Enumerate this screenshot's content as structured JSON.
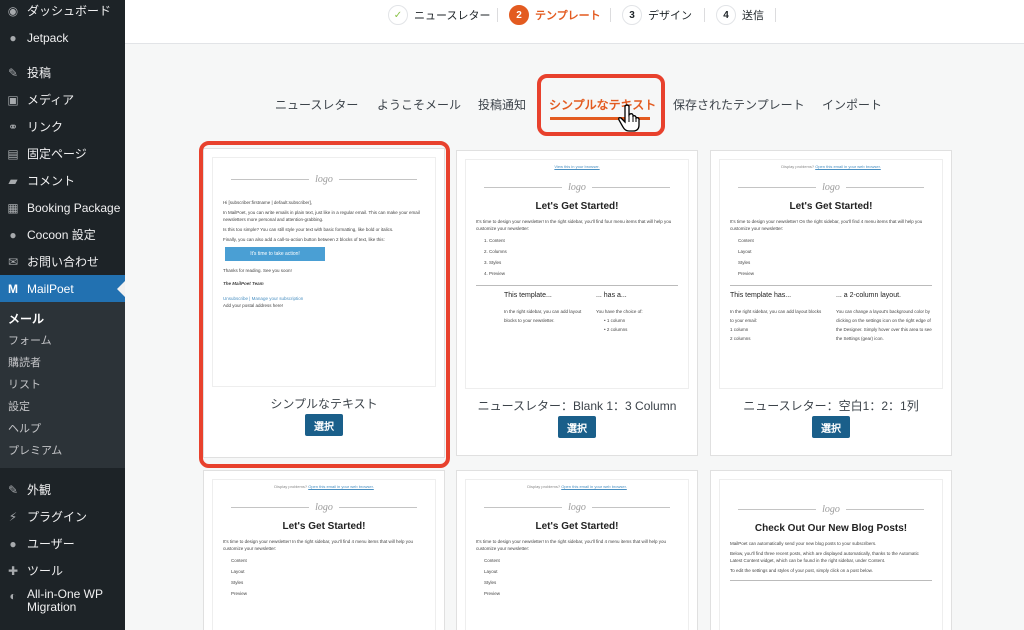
{
  "sidebar": {
    "items": [
      {
        "icon": "dashboard-icon",
        "glyph": "◉",
        "label": "ダッシュボード"
      },
      {
        "icon": "jetpack-icon",
        "glyph": "●",
        "label": "Jetpack"
      },
      {
        "icon": "pin-icon",
        "glyph": "✎",
        "label": "投稿"
      },
      {
        "icon": "media-icon",
        "glyph": "▣",
        "label": "メディア"
      },
      {
        "icon": "link-icon",
        "glyph": "⚭",
        "label": "リンク"
      },
      {
        "icon": "page-icon",
        "glyph": "▤",
        "label": "固定ページ"
      },
      {
        "icon": "comment-icon",
        "glyph": "▰",
        "label": "コメント"
      },
      {
        "icon": "calendar-icon",
        "glyph": "▦",
        "label": "Booking Package"
      },
      {
        "icon": "cocoon-icon",
        "glyph": "●",
        "label": "Cocoon 設定"
      },
      {
        "icon": "mail-icon",
        "glyph": "✉",
        "label": "お問い合わせ"
      },
      {
        "icon": "mailpoet-icon",
        "glyph": "M",
        "label": "MailPoet"
      }
    ],
    "submenu": [
      "メール",
      "フォーム",
      "購読者",
      "リスト",
      "設定",
      "ヘルプ",
      "プレミアム"
    ],
    "items_after": [
      {
        "icon": "appearance-icon",
        "glyph": "✎",
        "label": "外観"
      },
      {
        "icon": "plugin-icon",
        "glyph": "⚡",
        "label": "プラグイン"
      },
      {
        "icon": "user-icon",
        "glyph": "●",
        "label": "ユーザー"
      },
      {
        "icon": "tool-icon",
        "glyph": "✚",
        "label": "ツール"
      },
      {
        "icon": "migration-icon",
        "glyph": "◐",
        "label": "All-in-One WP Migration"
      }
    ]
  },
  "steps": [
    {
      "num": "✓",
      "label": "ニュースレター"
    },
    {
      "num": "2",
      "label": "テンプレート"
    },
    {
      "num": "3",
      "label": "デザイン"
    },
    {
      "num": "4",
      "label": "送信"
    }
  ],
  "tabs": [
    "ニュースレター",
    "ようこそメール",
    "投稿通知",
    "シンプルなテキスト",
    "保存されたテンプレート",
    "インポート"
  ],
  "select_label": "選択",
  "templates": [
    {
      "label": "シンプルなテキスト",
      "logo": "logo",
      "greeting": "Hi [subscriber:firstname | default:subscriber],",
      "p1": "In MailPoet, you can write emails in plain text, just like in a regular email. This can make your email newsletters more personal and attention-grabbing.",
      "p2": "Is this too simple? You can still style your text with basic formatting, like bold or italics.",
      "p3": "Finally, you can also add a call-to-action button between 2 blocks of text, like this:",
      "cta": "It's time to take action!",
      "thanks": "Thanks for reading. See you soon!",
      "team": "The MailPoet Team",
      "footer1": "Unsubscribe | Manage your subscription",
      "footer2": "Add your postal address here!"
    },
    {
      "label": "ニュースレター：Blank 1：3 Column",
      "browser": "View this in your browser.",
      "logo": "logo",
      "title": "Let's Get Started!",
      "intro": "It's time to design your newsletter! In the right sidebar, you'll find four menu items that will help you customize your newsletter:",
      "list": [
        "1.   Content",
        "2.   Columns",
        "3.   Styles",
        "4.   Preview"
      ],
      "col1_h": "This template...",
      "col1_t": "In the right sidebar, you can add layout blocks to your newsletter.",
      "col2_h": "... has a...",
      "col2_t": "You have the choice of:",
      "col2_l1": "• 1 column",
      "col2_l2": "• 2 columns"
    },
    {
      "label": "ニュースレター：空白1：2：1列",
      "browser_pre": "Display problems?",
      "browser": "Open this email in your web browser.",
      "logo": "logo",
      "title": "Let's Get Started!",
      "intro": "It's time to design your newsletter! On the right sidebar, you'll find 4 menu items that will help you customize your newsletter:",
      "list": [
        "Content",
        "Layout",
        "Styles",
        "Preview"
      ],
      "col1_h": "This template has...",
      "col1_t": "In the right sidebar, you can add layout blocks to your email:",
      "col1_l1": "1 column",
      "col1_l2": "2 columns",
      "col2_h": "... a 2-column layout.",
      "col2_t": "You can change a layout's background color by clicking on the settings icon on the right edge of the Designer. Simply hover over this area to see the Settings (gear) icon."
    },
    {
      "browser_pre": "Display problems?",
      "browser": "Open this email in your web browser.",
      "logo": "logo",
      "title": "Let's Get Started!",
      "intro": "It's time to design your newsletter! In the right sidebar, you'll find 4 menu items that will help you customize your newsletter:",
      "list": [
        "Content",
        "Layout",
        "Styles",
        "Preview"
      ]
    },
    {
      "browser_pre": "Display problems?",
      "browser": "Open this email in your web browser.",
      "logo": "logo",
      "title": "Let's Get Started!",
      "intro": "It's time to design your newsletter! In the right sidebar, you'll find 4 menu items that will help you customize your newsletter:",
      "list": [
        "Content",
        "Layout",
        "Styles",
        "Preview"
      ]
    },
    {
      "logo": "logo",
      "title": "Check Out Our New Blog Posts!",
      "p1": "MailPoet can automatically send your new blog posts to your subscribers.",
      "p2": "Below, you'll find three recent posts, which are displayed automatically, thanks to the Automatic Latest Content widget, which can be found in the right sidebar, under Content.",
      "p3": "To edit the settings and styles of your post, simply click on a post below."
    }
  ]
}
